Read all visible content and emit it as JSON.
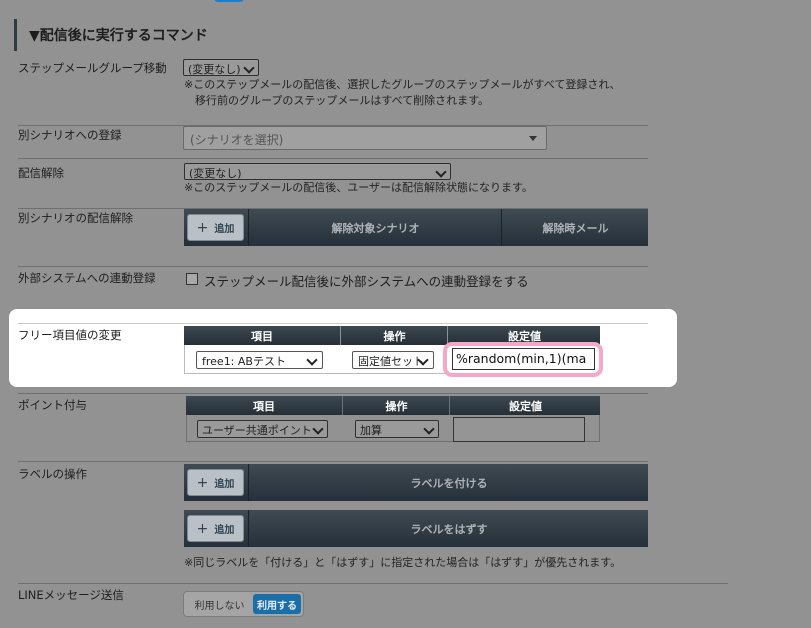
{
  "section_title": "▼配信後に実行するコマンド",
  "stepmail_group": {
    "label": "ステップメールグループ移動",
    "select": "(変更なし)",
    "note1": "※このステップメールの配信後、選択したグループのステップメールがすべて登録され、",
    "note2": "　移行前のグループのステップメールはすべて削除されます。"
  },
  "scenario_register": {
    "label": "別シナリオへの登録",
    "select": "(シナリオを選択)"
  },
  "unsubscribe": {
    "label": "配信解除",
    "select": "(変更なし)",
    "note": "※このステップメールの配信後、ユーザーは配信解除状態になります。"
  },
  "scenario_unsub": {
    "label": "別シナリオの配信解除",
    "add": "追加",
    "col1": "解除対象シナリオ",
    "col2": "解除時メール"
  },
  "external": {
    "label": "外部システムへの連動登録",
    "checkbox": "ステップメール配信後に外部システムへの連動登録をする"
  },
  "free_item": {
    "label": "フリー項目値の変更",
    "headers": [
      "項目",
      "操作",
      "設定値"
    ],
    "item_select": "free1: ABテスト",
    "op_select": "固定値セット",
    "value": "%random(min,1)(ma"
  },
  "points": {
    "label": "ポイント付与",
    "headers": [
      "項目",
      "操作",
      "設定値"
    ],
    "item_select": "ユーザー共通ポイント",
    "op_select": "加算",
    "value": ""
  },
  "labels": {
    "label": "ラベルの操作",
    "add1": "追加",
    "attach": "ラベルを付ける",
    "add2": "追加",
    "detach": "ラベルをはずす",
    "note": "※同じラベルを「付ける」と「はずす」に指定された場合は「はずす」が優先されます。"
  },
  "line": {
    "label": "LINEメッセージ送信",
    "off": "利用しない",
    "on": "利用する"
  },
  "colors": {
    "highlight": "#f6a8c9",
    "primary": "#1a7fd0"
  }
}
